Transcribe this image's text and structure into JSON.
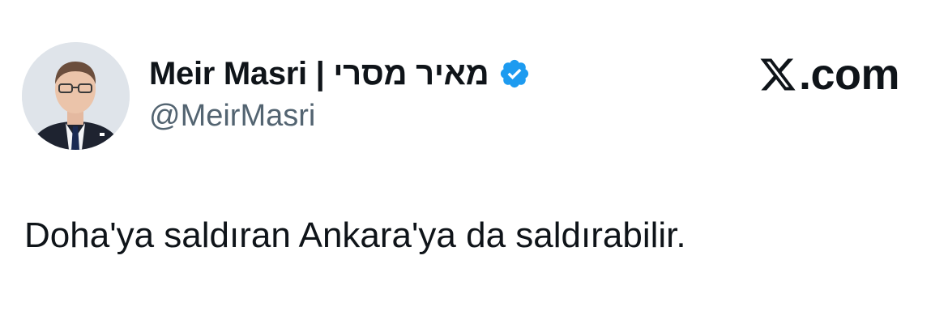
{
  "author": {
    "display_name": "Meir Masri | מאיר מסרי",
    "handle": "@MeirMasri",
    "verified": true
  },
  "brand": {
    "logo_icon": "x-logo-icon",
    "suffix": ".com"
  },
  "tweet": {
    "text": "Doha'ya saldıran Ankara'ya da saldırabilir."
  },
  "colors": {
    "text_primary": "#0f1419",
    "text_secondary": "#536471",
    "verified_blue": "#1d9bf0",
    "background": "#ffffff"
  }
}
